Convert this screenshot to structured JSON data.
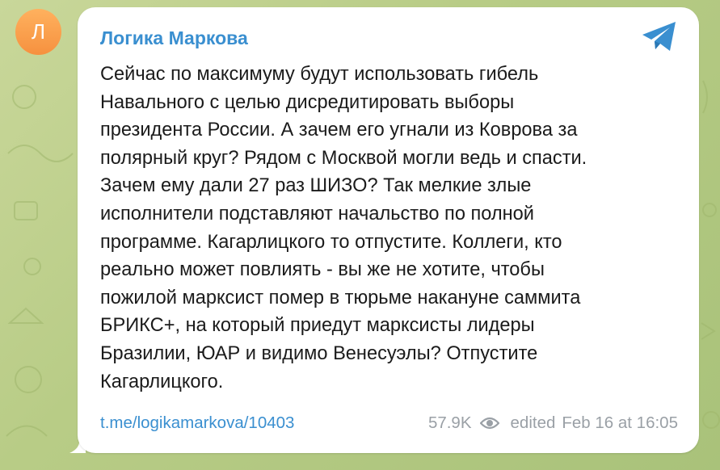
{
  "post": {
    "avatar_letter": "Л",
    "channel_name": "Логика Маркова",
    "message_lines": [
      "Сейчас по максимуму будут использовать гибель",
      "Навального с целью дисредитировать выборы",
      "президента России. А зачем его угнали из Коврова за",
      "полярный круг? Рядом с Москвой могли ведь и спасти.",
      "Зачем ему дали 27 раз ШИЗО? Так мелкие злые",
      "исполнители подставляют начальство по полной",
      "программе. Кагарлицкого то отпустите. Коллеги, кто",
      "реально может повлиять - вы же не хотите, чтобы",
      "пожилой марксист помер в тюрьме накануне саммита",
      "БРИКС+, на который приедут марксисты лидеры",
      "Бразилии, ЮАР и видимо Венесуэлы? Отпустите",
      "Кагарлицкого."
    ],
    "link": "t.me/logikamarkova/10403",
    "views": "57.9K",
    "edited_label": "edited",
    "timestamp": "Feb 16 at 16:05"
  },
  "icons": {
    "share": "telegram-plane-icon",
    "views": "eye-icon"
  },
  "colors": {
    "accent": "#3a8fd0",
    "avatar": "#f6913f",
    "meta_text": "#9aa0a6",
    "background": "#b8cc86"
  }
}
